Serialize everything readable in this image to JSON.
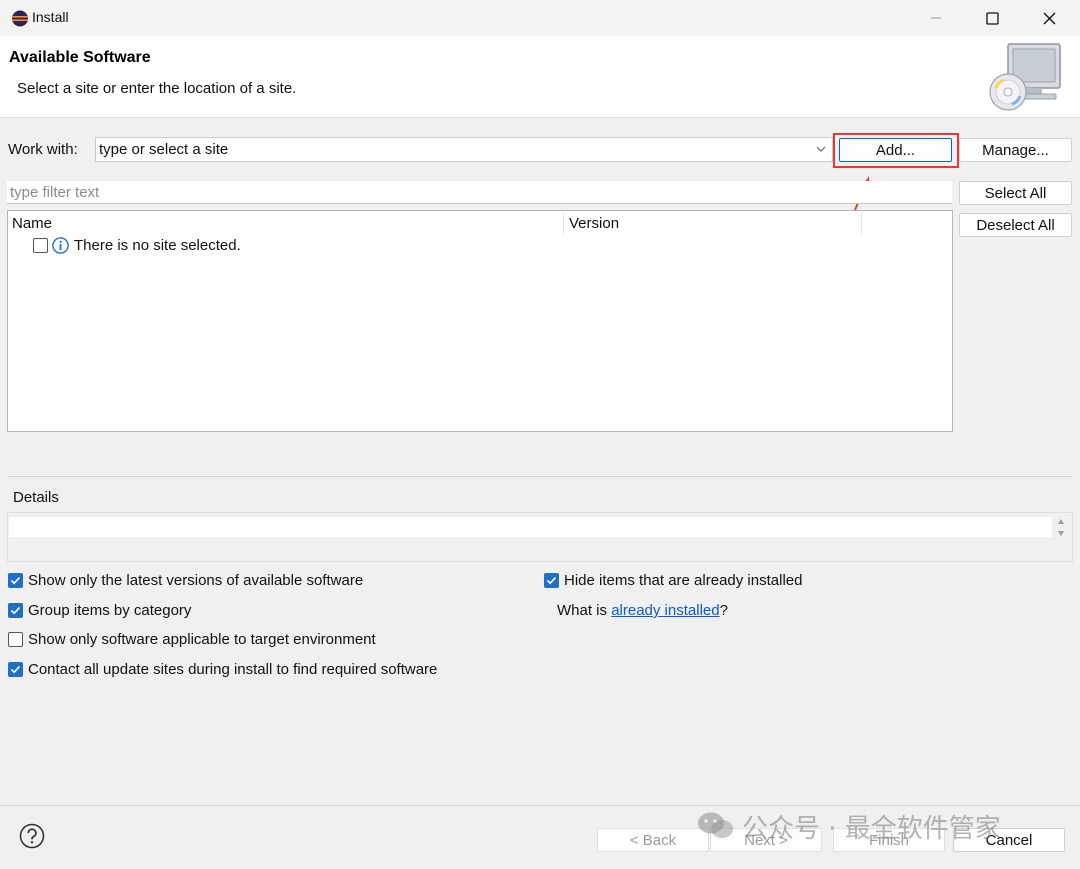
{
  "window": {
    "title": "Install",
    "controls": [
      "minimize-icon",
      "maximize-icon",
      "close-icon"
    ]
  },
  "header": {
    "title": "Available Software",
    "description": "Select a site or enter the location of a site.",
    "image_icon": "cd-monitor-icon"
  },
  "work_with": {
    "label": "Work with:",
    "combo_value": "type or select a site",
    "add_button": "Add...",
    "manage_button": "Manage..."
  },
  "filter": {
    "placeholder": "type filter text"
  },
  "side_buttons": {
    "select_all": "Select All",
    "deselect_all": "Deselect All"
  },
  "tree": {
    "columns": [
      "Name",
      "Version"
    ],
    "rows": [
      {
        "checked": false,
        "icon": "info-icon",
        "text": "There is no site selected."
      }
    ]
  },
  "details": {
    "title": "Details",
    "content": ""
  },
  "options_left": [
    {
      "label": "Show only the latest versions of available software",
      "checked": true
    },
    {
      "label": "Group items by category",
      "checked": true
    },
    {
      "label": "Show only software applicable to target environment",
      "checked": false
    },
    {
      "label": "Contact all update sites during install to find required software",
      "checked": true
    }
  ],
  "options_right": {
    "hide_installed": {
      "label": "Hide items that are already installed",
      "checked": true
    },
    "what_is_prefix": "What is ",
    "what_is_link": "already installed",
    "what_is_suffix": "?"
  },
  "footer": {
    "help_icon": "question-icon",
    "back": "< Back",
    "next": "Next >",
    "finish": "Finish",
    "cancel": "Cancel"
  },
  "watermark": {
    "text": "公众号 · 最全软件管家",
    "icon": "wechat-icon"
  },
  "colors": {
    "accent": "#1f6fc5",
    "link": "#0b5bd3",
    "annotation": "#e53935"
  }
}
